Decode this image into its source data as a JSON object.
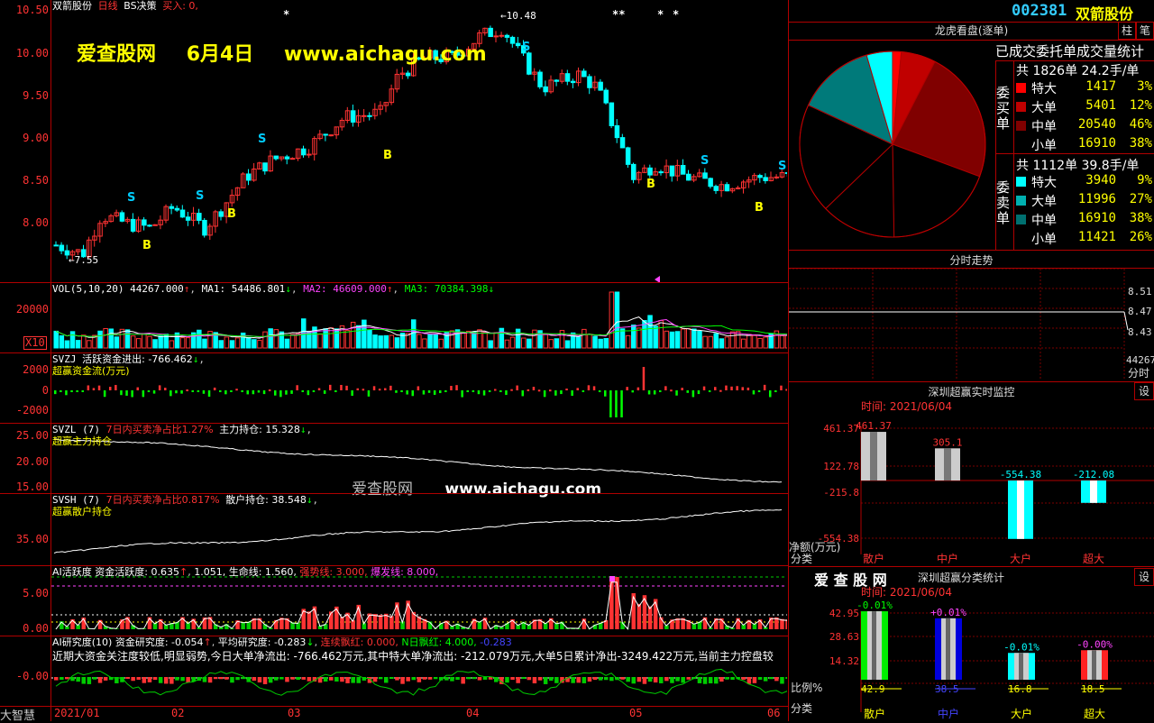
{
  "kline": {
    "title_stock": "双箭股份",
    "title_period": "日线",
    "title_strategy": "BS决策",
    "title_buy": "买入: 0,",
    "yaxis": [
      "10.50",
      "10.00",
      "9.50",
      "9.00",
      "8.50",
      "8.00"
    ],
    "high_label": "10.48",
    "low_label": "7.55",
    "watermark_site": "爱查股网",
    "watermark_date": "6月4日",
    "watermark_url": "www.aichagu.com",
    "star_marks": [
      "*",
      "**",
      "*",
      "*"
    ],
    "b_label": "B",
    "s_label": "S"
  },
  "vol": {
    "label": "VOL(5,10,20)",
    "value": "44267.000",
    "ma1": "MA1: 54486.801",
    "ma2": "MA2: 46609.000",
    "ma3": "MA3: 70384.398",
    "yaxis": "20000",
    "unit": "X10"
  },
  "svzj": {
    "label": "SVZJ",
    "title": "活跃资金进出: -766.462",
    "subtitle": "超赢资金流(万元)",
    "yaxis": [
      "2000",
      "0",
      "-2000"
    ]
  },
  "svzl": {
    "label": "SVZL (7)",
    "ratio": "7日内买卖净占比1.27%",
    "hold": "主力持仓: 15.328",
    "subtitle": "超赢主力持仓",
    "yaxis": [
      "25.00",
      "20.00",
      "15.00"
    ],
    "watermark1": "爱查股网",
    "watermark2": "www.aichagu.com"
  },
  "svsh": {
    "label": "SVSH (7)",
    "ratio": "7日内买卖净占比0.817%",
    "hold": "散户持仓: 38.548",
    "subtitle": "超赢散户持仓",
    "yaxis": [
      "35.00"
    ]
  },
  "ai_active": {
    "label": "AI活跃度",
    "v1": "资金活跃度: 0.635",
    "v2": "1.051,",
    "v3": "生命线: 1.560,",
    "v4": "强势线: 3.000,",
    "v5": "爆发线: 8.000,",
    "yaxis": [
      "5.00",
      "0.00"
    ]
  },
  "ai_research": {
    "label": "AI研究度(10)",
    "v1": "资金研究度: -0.054",
    "v2": "平均研究度: -0.283",
    "v3": "连续飘红: 0.000,",
    "v4": "N日飘红: 4.000,",
    "v5": "-0.283",
    "comment": "近期大资金关注度较低,明显弱势,今日大单净流出: -766.462万元,其中特大单净流出: -212.079万元,大单5日累计净出-3249.422万元,当前主力控盘较",
    "yaxis": "-0.00",
    "corner": "大智慧"
  },
  "dates": [
    "2021/01",
    "02",
    "03",
    "04",
    "05",
    "06"
  ],
  "right": {
    "code": "002381",
    "name": "双箭股份",
    "btn1": "柱",
    "btn2": "笔",
    "longhu_title": "龙虎看盘(逐单)",
    "stat_title": "已成交委托单成交量统计",
    "buy_side": "委买单",
    "sell_side": "委卖单",
    "buy_total": "共 1826单 24.2手/单",
    "sell_total": "共 1112单 39.8手/单",
    "buy_rows": [
      {
        "name": "特大",
        "count": "1417",
        "pct": "3%",
        "color": "#ff0000"
      },
      {
        "name": "大单",
        "count": "5401",
        "pct": "12%",
        "color": "#c00000"
      },
      {
        "name": "中单",
        "count": "20540",
        "pct": "46%",
        "color": "#800000"
      },
      {
        "name": "小单",
        "count": "16910",
        "pct": "38%",
        "color": "#000000"
      }
    ],
    "sell_rows": [
      {
        "name": "特大",
        "count": "3940",
        "pct": "9%",
        "color": "#00ffff"
      },
      {
        "name": "大单",
        "count": "11996",
        "pct": "27%",
        "color": "#00b0b0"
      },
      {
        "name": "中单",
        "count": "16910",
        "pct": "38%",
        "color": "#007070"
      },
      {
        "name": "小单",
        "count": "11421",
        "pct": "26%",
        "color": "#000000"
      }
    ],
    "fenshi_title": "分时走势",
    "fenshi_y": [
      "8.51",
      "8.47",
      "8.43"
    ],
    "fenshi_vol": "44267",
    "fenshi_label": "分时",
    "monitor_title": "深圳超赢实时监控",
    "monitor_btn": "设",
    "monitor_time": "时间: 2021/06/04",
    "monitor_y": [
      "461.37",
      "122.78",
      "-215.8",
      "-554.38"
    ],
    "monitor_unit": "净额(万元)",
    "monitor_cat": "分类",
    "monitor_vals": [
      "461.37",
      "305.1",
      "-554.38",
      "-212.08"
    ],
    "categories": [
      "散户",
      "中户",
      "大户",
      "超大"
    ],
    "stat_logo": "爱 查 股 网",
    "stat_title2": "深圳超赢分类统计",
    "stat_btn": "设",
    "stat_time": "时间: 2021/06/04",
    "stat_y": [
      "42.95",
      "28.63",
      "14.32"
    ],
    "stat_unit": "比例%",
    "stat_cat": "分类",
    "stat_top": [
      "-0.01%",
      "+0.01%",
      "-0.01%",
      "-0.00%"
    ],
    "stat_bottom": [
      "42.9",
      "38.5",
      "16.8",
      "18.5"
    ]
  }
}
